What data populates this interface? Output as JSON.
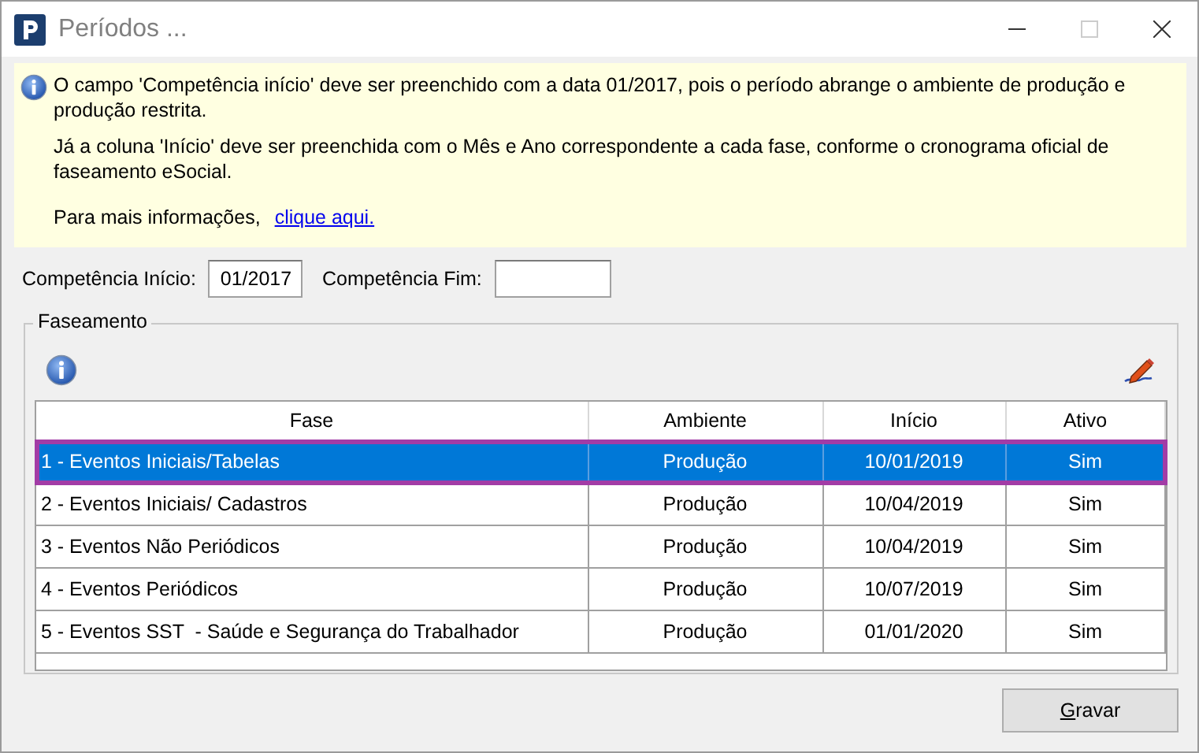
{
  "window": {
    "title": "Períodos ..."
  },
  "info": {
    "paragraphs": [
      "O campo 'Competência início' deve ser preenchido com a data 01/2017, pois o período abrange o ambiente de produção e produção restrita.",
      "Já a coluna 'Início' deve ser preenchida com o Mês e Ano correspondente a cada fase, conforme o cronograma oficial de faseamento eSocial."
    ],
    "more_text": "Para mais informações,",
    "link": "clique aqui."
  },
  "fields": [
    {
      "label": "Competência Início:",
      "value": "01/2017"
    },
    {
      "label": "Competência Fim:"
    }
  ],
  "group": {
    "title": "Faseamento"
  },
  "table": {
    "columns": [
      "Fase",
      "Ambiente",
      "Início",
      "Ativo"
    ],
    "rows": [
      {
        "cells": [
          "1 - Eventos Iniciais/Tabelas",
          "Produção",
          "10/01/2019",
          "Sim"
        ],
        "selected": true
      },
      {
        "cells": [
          "2 - Eventos Iniciais/ Cadastros",
          "Produção",
          "10/04/2019",
          "Sim"
        ],
        "selected": false
      },
      {
        "cells": [
          "3 - Eventos Não Periódicos",
          "Produção",
          "10/04/2019",
          "Sim"
        ],
        "selected": false
      },
      {
        "cells": [
          "4 - Eventos Periódicos",
          "Produção",
          "10/07/2019",
          "Sim"
        ],
        "selected": false
      },
      {
        "cells": [
          "5 - Eventos SST  - Saúde e Segurança do Trabalhador",
          "Produção",
          "01/01/2020",
          "Sim"
        ],
        "selected": false
      }
    ]
  },
  "buttons": [
    {
      "label": "Gravar"
    }
  ]
}
